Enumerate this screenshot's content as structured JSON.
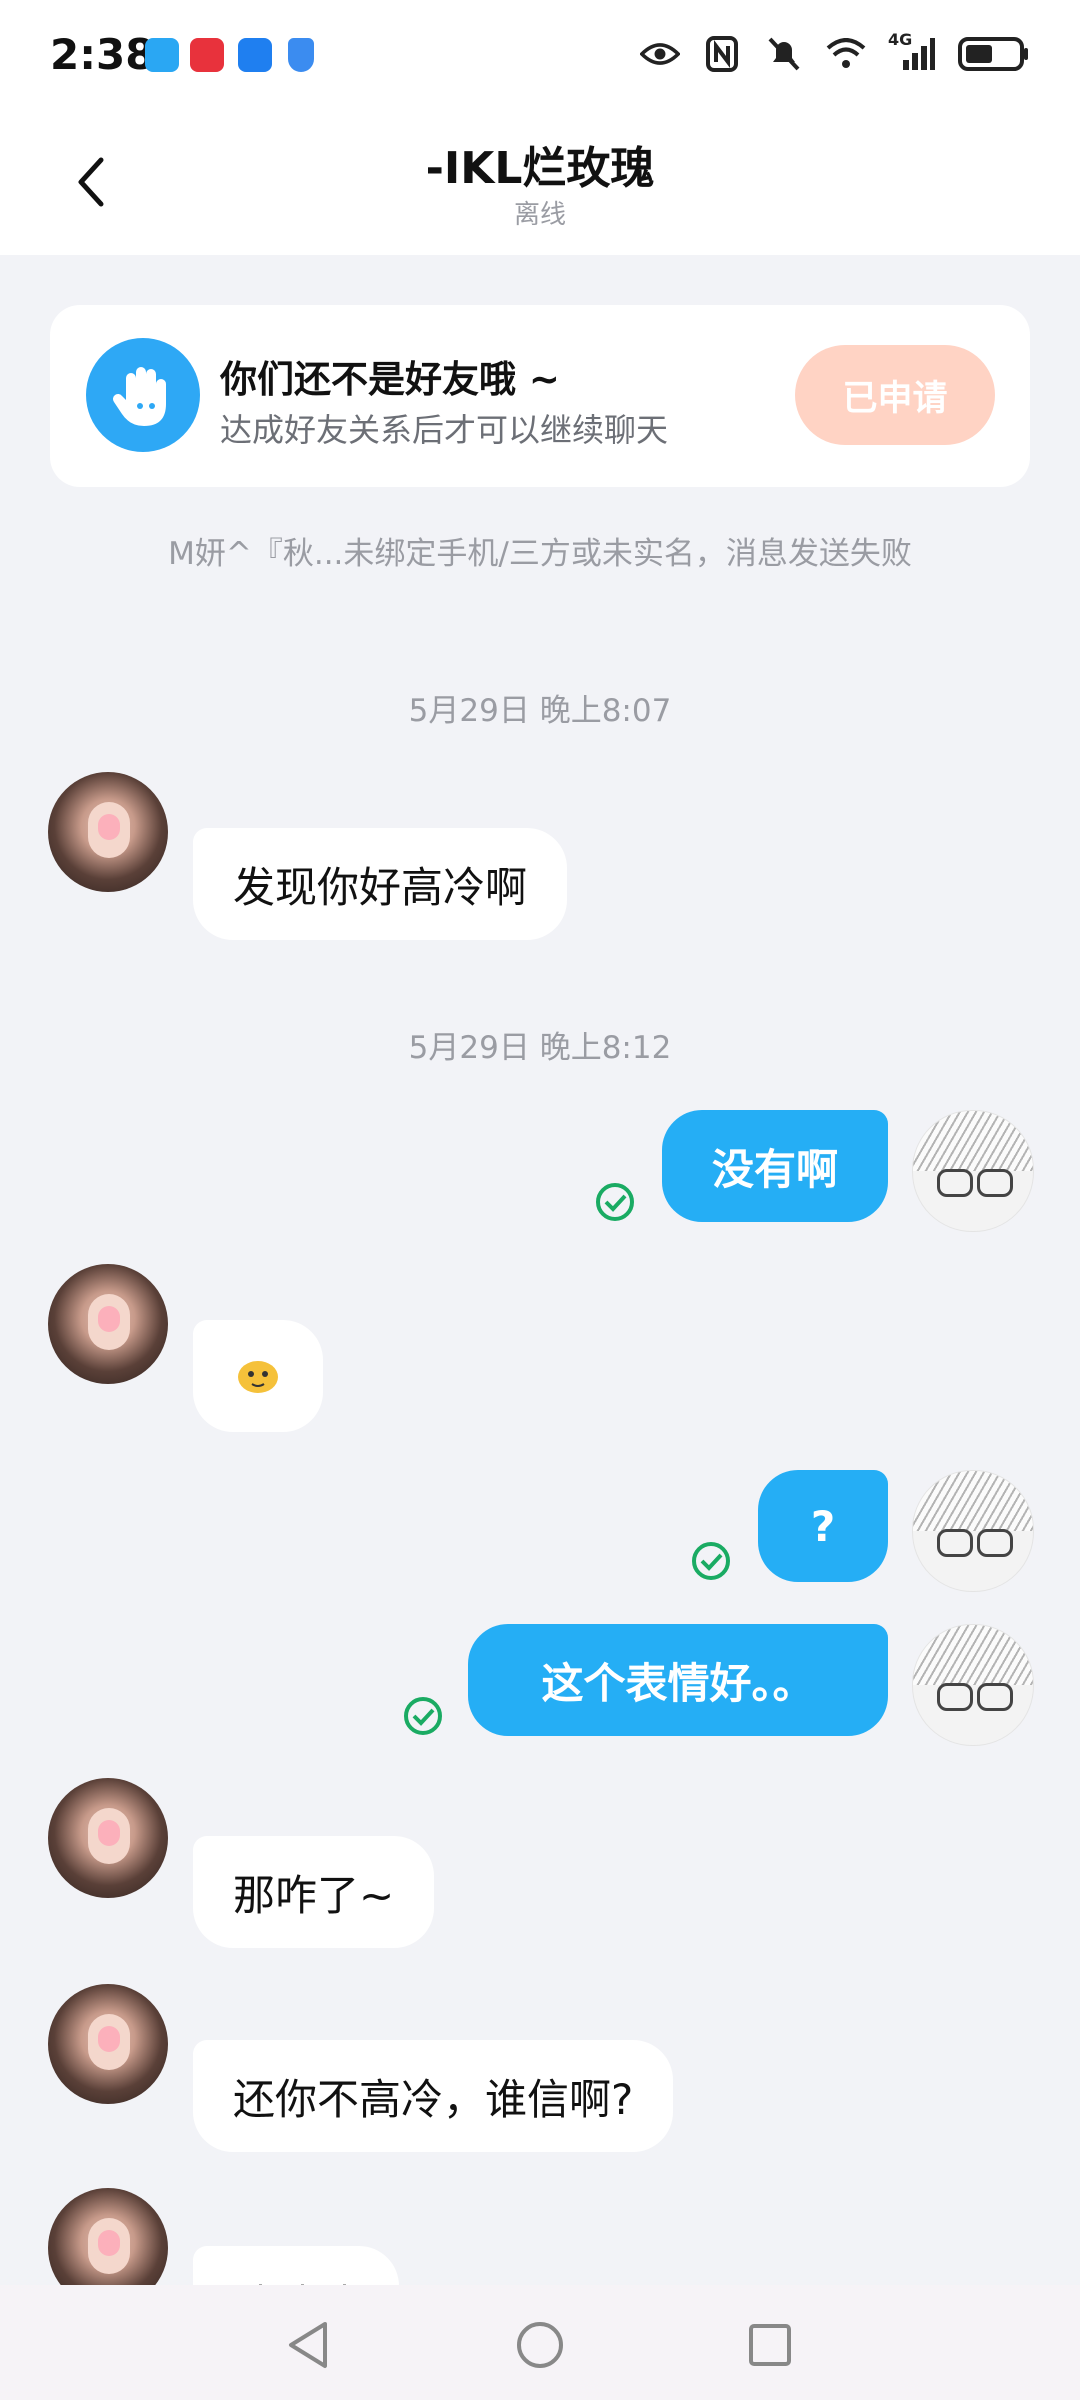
{
  "status_bar": {
    "time": "2:38",
    "network": "4G"
  },
  "header": {
    "title": "-IKL烂玫瑰",
    "status": "离线"
  },
  "friend_card": {
    "title": "你们还不是好友哦 ~",
    "subtitle": "达成好友关系后才可以继续聊天",
    "button": "已申请"
  },
  "notice": "M妍^『秋...未绑定手机/三方或未实名，消息发送失败",
  "messages": [
    {
      "kind": "timestamp",
      "text": "5月29日 晚上8:07"
    },
    {
      "kind": "in",
      "text": "发现你好高冷啊"
    },
    {
      "kind": "timestamp",
      "text": "5月29日 晚上8:12"
    },
    {
      "kind": "out",
      "text": "没有啊"
    },
    {
      "kind": "in",
      "text": "",
      "sticker": "sticker-icon"
    },
    {
      "kind": "out",
      "text": "?"
    },
    {
      "kind": "out",
      "text": "这个表情好。。"
    },
    {
      "kind": "in",
      "text": "那咋了~"
    },
    {
      "kind": "in",
      "text": "还你不高冷，谁信啊?"
    },
    {
      "kind": "in",
      "text": "啧啧啧"
    }
  ],
  "colors": {
    "outgoing_bubble": "#25aef5",
    "applied_button": "#ffd3c4",
    "read_check": "#1aab63"
  }
}
